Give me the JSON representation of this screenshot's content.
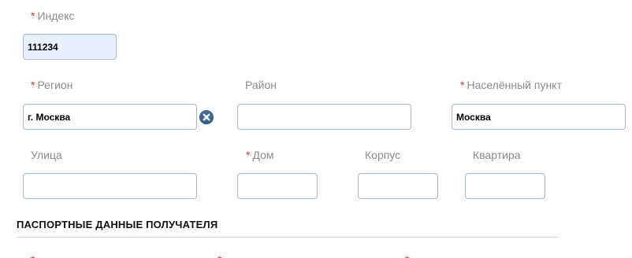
{
  "address": {
    "index": {
      "label": "Индекс",
      "required": "*",
      "value": "111234"
    },
    "region": {
      "label": "Регион",
      "required": "*",
      "value": "г. Москва"
    },
    "district": {
      "label": "Район",
      "value": ""
    },
    "locality": {
      "label": "Населённый пункт",
      "required": "*",
      "value": "Москва"
    },
    "street": {
      "label": "Улица",
      "value": ""
    },
    "house": {
      "label": "Дом",
      "required": "*",
      "value": ""
    },
    "building": {
      "label": "Корпус",
      "value": ""
    },
    "apartment": {
      "label": "Квартира",
      "value": ""
    }
  },
  "clear_icon": "clear-circle-x-icon",
  "passport": {
    "section_title": "ПАСПОРТНЫЕ ДАННЫЕ ПОЛУЧАТЕЛЯ",
    "req_mark": "*"
  },
  "colors": {
    "required_asterisk": "#d9301f",
    "label_text": "#8a8a8a",
    "field_border": "#a6b9c9",
    "autofill_bg": "#e8f0fe",
    "clear_button": "#3f6c9c"
  }
}
